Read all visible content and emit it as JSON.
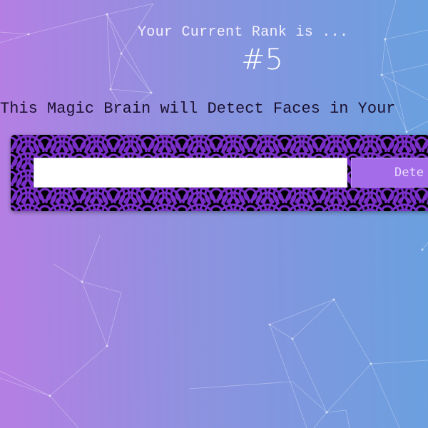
{
  "rank": {
    "caption": "Your Current Rank is ...",
    "value": "#5"
  },
  "intro": {
    "text": "This Magic Brain will Detect Faces in Your"
  },
  "form": {
    "input_value": "",
    "button_label": "Dete"
  },
  "colors": {
    "gradient_left": "#b57ee3",
    "gradient_right": "#6aa0df",
    "button": "#a46ce8",
    "pattern_purple": "#7a2fc8",
    "pattern_dark": "#000000"
  }
}
